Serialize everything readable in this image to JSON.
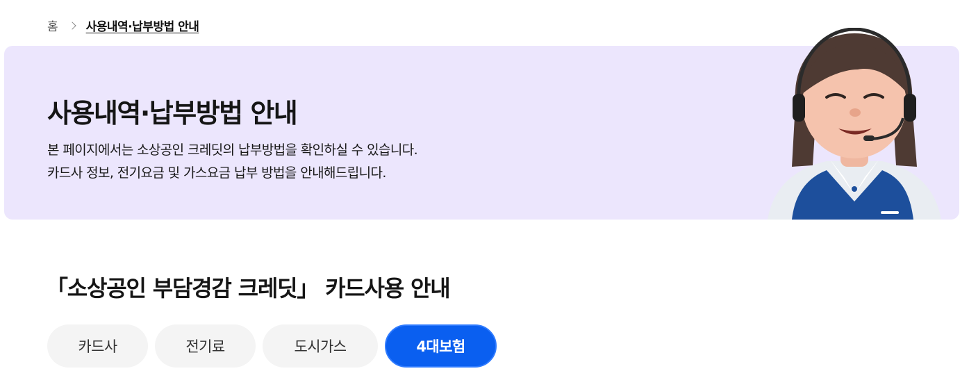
{
  "breadcrumb": {
    "home": "홈",
    "current": "사용내역·납부방법 안내"
  },
  "banner": {
    "title": "사용내역·납부방법 안내",
    "desc_line1": "본 페이지에서는 소상공인 크레딧의 납부방법을 확인하실 수 있습니다.",
    "desc_line2": "카드사 정보, 전기요금 및 가스요금 납부 방법을 안내해드립니다."
  },
  "section": {
    "title": "「소상공인 부담경감 크레딧」 카드사용 안내"
  },
  "tabs": [
    {
      "label": "카드사",
      "active": false
    },
    {
      "label": "전기료",
      "active": false
    },
    {
      "label": "도시가스",
      "active": false
    },
    {
      "label": "4대보험",
      "active": true
    }
  ],
  "colors": {
    "banner_bg": "#ece6fd",
    "accent": "#0a5ff0",
    "tab_bg": "#f4f4f4"
  }
}
